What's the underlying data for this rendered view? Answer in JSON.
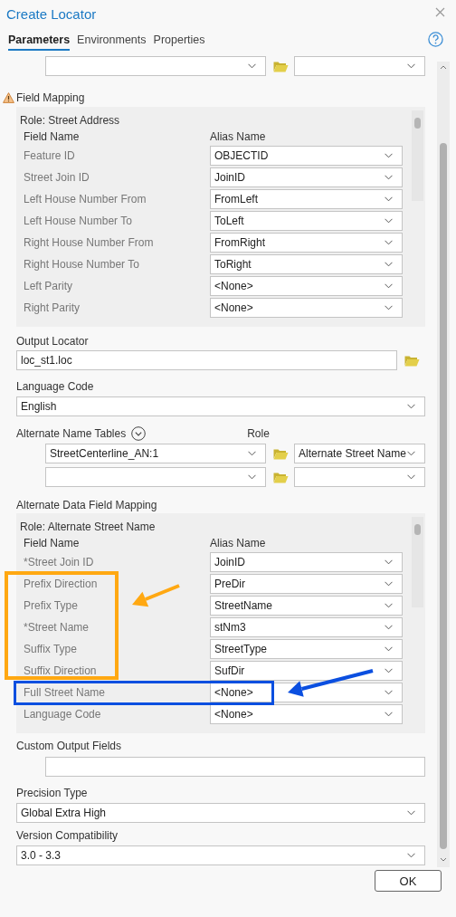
{
  "window": {
    "title": "Create Locator"
  },
  "tabs": [
    {
      "label": "Parameters",
      "selected": true
    },
    {
      "label": "Environments",
      "selected": false
    },
    {
      "label": "Properties",
      "selected": false
    }
  ],
  "field_mapping": {
    "title": "Field Mapping",
    "warning": true,
    "role": "Role: Street Address",
    "columns": [
      "Field Name",
      "Alias Name"
    ],
    "rows": [
      {
        "field": "Feature ID",
        "alias": "OBJECTID"
      },
      {
        "field": "Street Join ID",
        "alias": "JoinID"
      },
      {
        "field": "Left House Number From",
        "alias": "FromLeft"
      },
      {
        "field": "Left House Number To",
        "alias": "ToLeft"
      },
      {
        "field": "Right House Number From",
        "alias": "FromRight"
      },
      {
        "field": "Right House Number To",
        "alias": "ToRight"
      },
      {
        "field": "Left Parity",
        "alias": "<None>"
      },
      {
        "field": "Right Parity",
        "alias": "<None>"
      }
    ]
  },
  "output_locator": {
    "label": "Output Locator",
    "value": "loc_st1.loc"
  },
  "language_code": {
    "label": "Language Code",
    "value": "English"
  },
  "alternate_name_tables": {
    "label": "Alternate Name Tables",
    "role_label": "Role",
    "rows": [
      {
        "table": "StreetCenterline_AN:1",
        "role": "Alternate Street Name"
      },
      {}
    ]
  },
  "alternate_data_field_mapping": {
    "title": "Alternate Data Field Mapping",
    "role": "Role: Alternate Street Name",
    "columns": [
      "Field Name",
      "Alias Name"
    ],
    "rows": [
      {
        "field": "*Street Join ID",
        "alias": "JoinID"
      },
      {
        "field": "Prefix Direction",
        "alias": "PreDir"
      },
      {
        "field": "Prefix Type",
        "alias": "StreetName"
      },
      {
        "field": "*Street Name",
        "alias": "stNm3"
      },
      {
        "field": "Suffix Type",
        "alias": "StreetType"
      },
      {
        "field": "Suffix Direction",
        "alias": "SufDir"
      },
      {
        "field": "Full Street Name",
        "alias": "<None>"
      },
      {
        "field": "Language Code",
        "alias": "<None>"
      }
    ]
  },
  "custom_output_fields": {
    "label": "Custom Output Fields"
  },
  "precision_type": {
    "label": "Precision Type",
    "value": "Global Extra High"
  },
  "version_compatibility": {
    "label": "Version Compatibility",
    "value": "3.0 - 3.3"
  },
  "buttons": [
    "OK"
  ],
  "annotations": [
    {
      "kind": "box",
      "color": "#ffa812"
    },
    {
      "kind": "arrow",
      "color": "#ffa812"
    },
    {
      "kind": "box",
      "color": "#0b4fe0"
    },
    {
      "kind": "arrow",
      "color": "#0b4fe0"
    }
  ]
}
